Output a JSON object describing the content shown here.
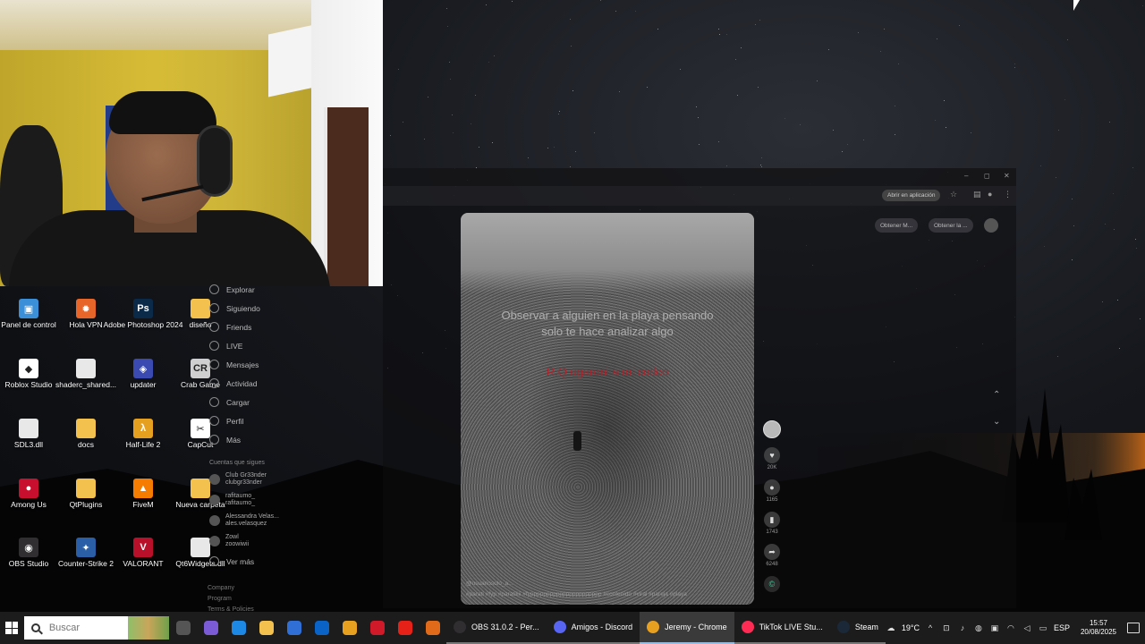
{
  "desktop_icons": [
    {
      "label": "Panel de control",
      "icon": "control-panel-icon",
      "color": "#3a8fd8",
      "glyph": "▣"
    },
    {
      "label": "Hola VPN",
      "icon": "hola-vpn-icon",
      "color": "#e8652a",
      "glyph": "✹"
    },
    {
      "label": "Adobe Photoshop 2024",
      "icon": "photoshop-icon",
      "color": "#0b2a4a",
      "glyph": "Ps"
    },
    {
      "label": "diseño",
      "icon": "folder-icon",
      "color": "#f2c14e",
      "glyph": ""
    },
    {
      "label": "Roblox Studio",
      "icon": "roblox-studio-icon",
      "color": "#ffffff",
      "glyph": "◆"
    },
    {
      "label": "shaderc_shared...",
      "icon": "file-icon",
      "color": "#e8e8e8",
      "glyph": ""
    },
    {
      "label": "updater",
      "icon": "updater-icon",
      "color": "#3a4ab0",
      "glyph": "◈"
    },
    {
      "label": "Crab Game",
      "icon": "crab-game-icon",
      "color": "#cfcfcf",
      "glyph": "CR"
    },
    {
      "label": "SDL3.dll",
      "icon": "dll-file-icon",
      "color": "#e8e8e8",
      "glyph": ""
    },
    {
      "label": "docs",
      "icon": "folder-icon",
      "color": "#f2c14e",
      "glyph": ""
    },
    {
      "label": "Half-Life 2",
      "icon": "half-life-2-icon",
      "color": "#e6a020",
      "glyph": "λ"
    },
    {
      "label": "CapCut",
      "icon": "capcut-icon",
      "color": "#ffffff",
      "glyph": "✂"
    },
    {
      "label": "Among Us",
      "icon": "among-us-icon",
      "color": "#c8102e",
      "glyph": "●"
    },
    {
      "label": "QtPlugins",
      "icon": "folder-icon",
      "color": "#f2c14e",
      "glyph": ""
    },
    {
      "label": "FiveM",
      "icon": "fivem-icon",
      "color": "#f57c00",
      "glyph": "▲"
    },
    {
      "label": "Nueva carpeta",
      "icon": "folder-icon",
      "color": "#f2c14e",
      "glyph": ""
    },
    {
      "label": "OBS Studio",
      "icon": "obs-studio-icon",
      "color": "#302e31",
      "glyph": "◉"
    },
    {
      "label": "Counter-Strike 2",
      "icon": "counter-strike-2-icon",
      "color": "#2a5fa8",
      "glyph": "✦"
    },
    {
      "label": "VALORANT",
      "icon": "valorant-icon",
      "color": "#b8102a",
      "glyph": "V"
    },
    {
      "label": "Qt6Widgets.dll",
      "icon": "dll-file-icon",
      "color": "#e8e8e8",
      "glyph": ""
    }
  ],
  "sidebar": {
    "nav": [
      {
        "label": "Explorar",
        "icon": "explore-icon"
      },
      {
        "label": "Siguiendo",
        "icon": "following-icon"
      },
      {
        "label": "Friends",
        "icon": "friends-icon"
      },
      {
        "label": "LIVE",
        "icon": "live-icon"
      },
      {
        "label": "Mensajes",
        "icon": "messages-icon"
      },
      {
        "label": "Actividad",
        "icon": "activity-icon"
      },
      {
        "label": "Cargar",
        "icon": "upload-icon"
      },
      {
        "label": "Perfil",
        "icon": "profile-icon"
      },
      {
        "label": "Más",
        "icon": "more-icon"
      }
    ],
    "following_heading": "Cuentas que sigues",
    "accounts": [
      {
        "name": "Club Gr33nder",
        "handle": "clubgr33nder"
      },
      {
        "name": "rafitaumo_",
        "handle": "rafitaumo_"
      },
      {
        "name": "Alessandra Velas...",
        "handle": "ales.velasquez"
      },
      {
        "name": "Zowl",
        "handle": "zoowiwii"
      }
    ],
    "see_more": "Ver más",
    "footer": [
      "Company",
      "Program",
      "Terms & Policies"
    ]
  },
  "chrome": {
    "open_in_app": "Abrir en aplicación",
    "get_app_1": "Obtener M...",
    "get_app_2": "Obtener la ...",
    "minimize": "–",
    "maximize": "◻",
    "close": "✕"
  },
  "video": {
    "caption_lines": "Observar a alguien en la playa pensando solo te hace analizar algo",
    "caption_red": "R.Q ugaroni a mi codco",
    "username": "@usuariosolo_a...",
    "hashtags": "#parati #fyp #paratiiiii #fypppppppppppppppppppppp #contenido #viral #pareja #playa"
  },
  "actions": {
    "likes": "20K",
    "comments": "1165",
    "saves": "1743",
    "shares": "6248"
  },
  "taskbar": {
    "search_placeholder": "Buscar",
    "pinned": [
      {
        "icon": "task-view-icon",
        "color": "#555555"
      },
      {
        "icon": "copilot-icon",
        "color": "#7b5cd6"
      },
      {
        "icon": "edge-icon",
        "color": "#1e88e5"
      },
      {
        "icon": "file-explorer-icon",
        "color": "#f2c14e"
      },
      {
        "icon": "store-icon",
        "color": "#2f6fd6"
      },
      {
        "icon": "outlook-icon",
        "color": "#0a64c8"
      },
      {
        "icon": "chrome-icon",
        "color": "#e8a020"
      },
      {
        "icon": "opera-icon",
        "color": "#d01a2a"
      },
      {
        "icon": "youtube-icon",
        "color": "#e62117"
      },
      {
        "icon": "app-icon",
        "color": "#e06a1a"
      }
    ],
    "apps": [
      {
        "label": "OBS 31.0.2 - Per...",
        "icon": "obs-icon",
        "color": "#302e31",
        "active": false
      },
      {
        "label": "Amigos - Discord",
        "icon": "discord-icon",
        "color": "#5865f2",
        "active": false
      },
      {
        "label": "Jeremy - Chrome",
        "icon": "chrome-icon",
        "color": "#e8a020",
        "active": true
      },
      {
        "label": "TikTok LIVE Stu...",
        "icon": "tiktok-live-studio-icon",
        "color": "#fe2c55",
        "active": false
      },
      {
        "label": "Steam",
        "icon": "steam-icon",
        "color": "#1b2838",
        "active": false
      }
    ],
    "weather": "19°C",
    "language": "ESP",
    "time": "15:57",
    "date": "20/08/2025"
  }
}
